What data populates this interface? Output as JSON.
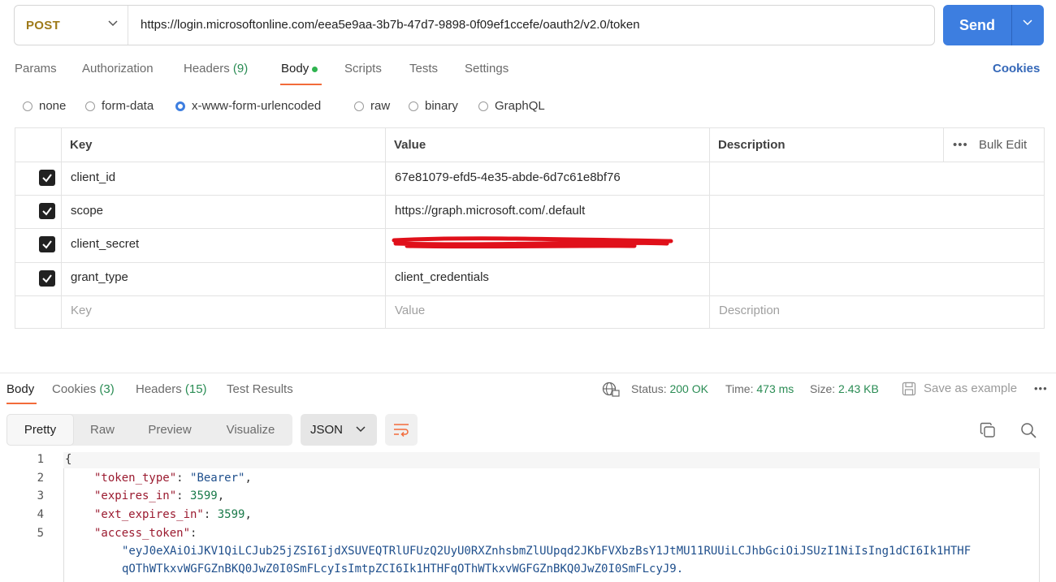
{
  "request": {
    "method": "POST",
    "url": "https://login.microsoftonline.com/eea5e9aa-3b7b-47d7-9898-0f09ef1ccefe/oauth2/v2.0/token",
    "send_label": "Send"
  },
  "tabs": [
    {
      "label": "Params"
    },
    {
      "label": "Authorization"
    },
    {
      "label": "Headers",
      "count": "(9)"
    },
    {
      "label": "Body"
    },
    {
      "label": "Scripts"
    },
    {
      "label": "Tests"
    },
    {
      "label": "Settings"
    }
  ],
  "cookies_label": "Cookies",
  "body_types": [
    "none",
    "form-data",
    "x-www-form-urlencoded",
    "raw",
    "binary",
    "GraphQL"
  ],
  "body_type_selected": "x-www-form-urlencoded",
  "table": {
    "headers": {
      "key": "Key",
      "value": "Value",
      "description": "Description"
    },
    "bulk_edit": "Bulk Edit",
    "rows": [
      {
        "key": "client_id",
        "value": "67e81079-efd5-4e35-abde-6d7c61e8bf76",
        "checked": true
      },
      {
        "key": "scope",
        "value": "https://graph.microsoft.com/.default",
        "checked": true
      },
      {
        "key": "client_secret",
        "value": "[redacted]",
        "checked": true
      },
      {
        "key": "grant_type",
        "value": "client_credentials",
        "checked": true
      }
    ],
    "placeholders": {
      "key": "Key",
      "value": "Value",
      "description": "Description"
    }
  },
  "response": {
    "tabs": [
      {
        "label": "Body"
      },
      {
        "label": "Cookies",
        "count": "(3)"
      },
      {
        "label": "Headers",
        "count": "(15)"
      },
      {
        "label": "Test Results"
      }
    ],
    "status_label": "Status:",
    "status_value": "200 OK",
    "time_label": "Time:",
    "time_value": "473 ms",
    "size_label": "Size:",
    "size_value": "2.43 KB",
    "save_example": "Save as example",
    "views": [
      "Pretty",
      "Raw",
      "Preview",
      "Visualize"
    ],
    "format": "JSON",
    "code_lines": {
      "l1": "{",
      "l2_key": "\"token_type\"",
      "l2_val": "\"Bearer\"",
      "l3_key": "\"expires_in\"",
      "l3_val": "3599",
      "l4_key": "\"ext_expires_in\"",
      "l4_val": "3599",
      "l5_key": "\"access_token\"",
      "l5_val_a": "\"eyJ0eXAiOiJKV1QiLCJub25jZSI6IjdXSUVEQTRlUFUzQ2UyU0RXZnhsbmZlUUpqd2JKbFVXbzBsY1JtMU11RUUiLCJhbGciOiJSUzI1NiIsIng1dCI6Ik1HTHF",
      "l5_val_b": "qOThWTkxvWGFGZnBKQ0JwZ0I0SmFLcyIsImtpZCI6Ik1HTHFqOThWTkxvWGFGZnBKQ0JwZ0I0SmFLcyJ9."
    }
  }
}
